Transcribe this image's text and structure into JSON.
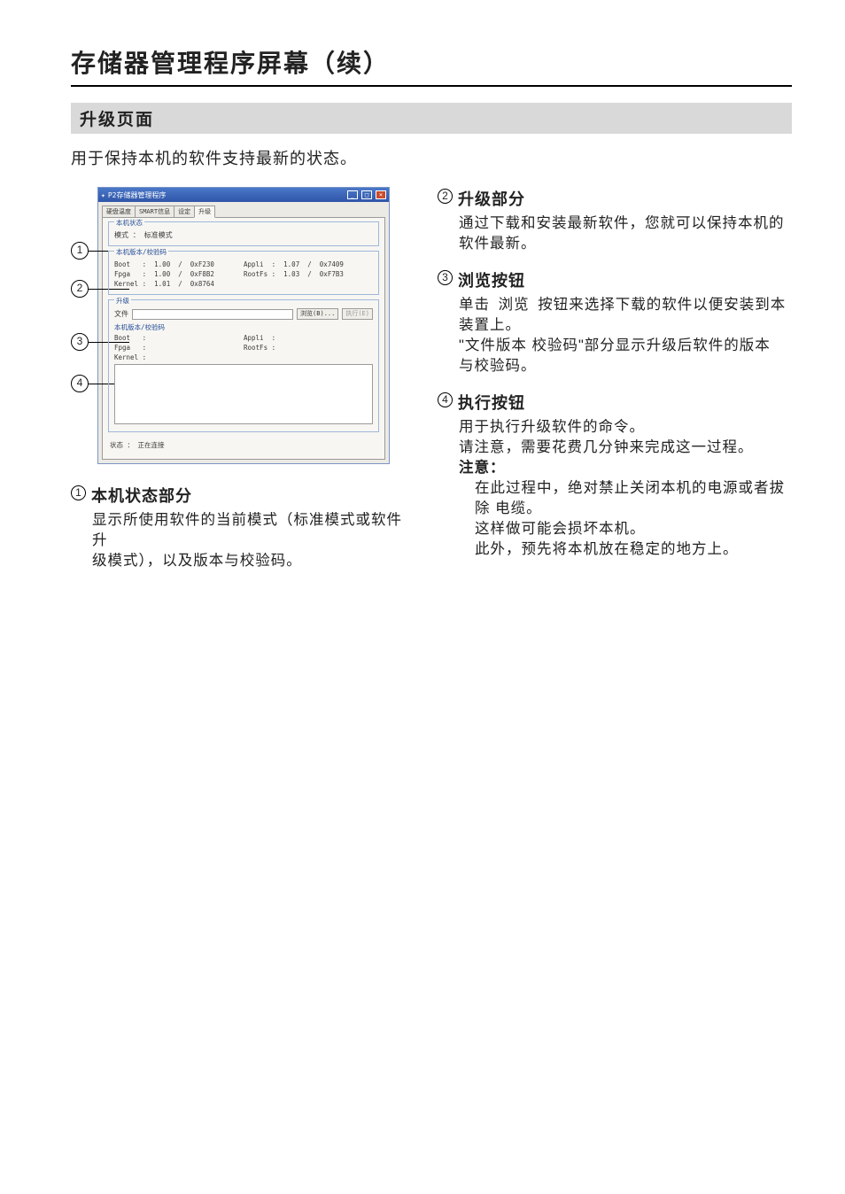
{
  "page": {
    "title": "存储器管理程序屏幕（续）",
    "section_bar": "升级页面",
    "intro": "用于保持本机的软件支持最新的状态。"
  },
  "shot": {
    "window_title": "P2存储器管理程序",
    "tabs": [
      "硬盘温度",
      "SMART信息",
      "设定",
      "升级"
    ],
    "active_tab": 3,
    "status_group": {
      "title": "本机状态",
      "mode_label": "模式  ：",
      "mode_value": "标准模式"
    },
    "ver_group": {
      "title": "本机版本/校验码",
      "left": "Boot   :  1.00  /  0xF230\nFpga   :  1.00  /  0xF8B2\nKernel :  1.01  /  0x8764",
      "right": "Appli  :  1.07  /  0x7409\nRootFs :  1.03  /  0xF7B3"
    },
    "upg_group": {
      "title": "升级",
      "file_label": "文件",
      "browse_btn": "浏览(B)...",
      "exec_btn": "执行(E)",
      "filever_title": "本机版本/校验码",
      "left": "Boot   :\nFpga   :\nKernel :",
      "right": "Appli  :\nRootFs :"
    },
    "status_line_label": "状态  ：",
    "status_line_value": "正在连接"
  },
  "callouts": {
    "1": "1",
    "2": "2",
    "3": "3",
    "4": "4"
  },
  "desc": {
    "d1": {
      "num": "1",
      "title": "本机状态部分",
      "body_l1": "显示所使用软件的当前模式（标准模式或软件升",
      "body_l2": "级模式），以及版本与校验码。"
    },
    "d2": {
      "num": "2",
      "title": "升级部分",
      "body_l1": "通过下载和安装最新软件，您就可以保持本机的",
      "body_l2": "软件最新。"
    },
    "d3": {
      "num": "3",
      "title": "浏览按钮",
      "body_l1_a": "单击",
      "body_l1_b": "浏览",
      "body_l1_c": "按钮来选择下载的软件以便安装到本",
      "body_l2": "装置上。",
      "body_l3": "\"文件版本  校验码\"部分显示升级后软件的版本",
      "body_l4": "与校验码。"
    },
    "d4": {
      "num": "4",
      "title": "执行按钮",
      "body_l1": "用于执行升级软件的命令。",
      "body_l2": "请注意，需要花费几分钟来完成这一过程。",
      "note_label": "注意：",
      "note_l1": "在此过程中，绝对禁止关闭本机的电源或者拔",
      "note_l2": "除            电缆。",
      "note_l3": "这样做可能会损坏本机。",
      "note_l4": "此外，预先将本机放在稳定的地方上。"
    }
  }
}
